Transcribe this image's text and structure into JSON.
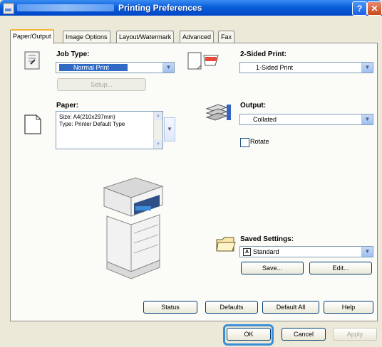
{
  "window": {
    "title": "Printing Preferences",
    "help_glyph": "?",
    "close_glyph": "✕"
  },
  "tabs": [
    {
      "label": "Paper/Output",
      "active": true
    },
    {
      "label": "Image Options",
      "active": false
    },
    {
      "label": "Layout/Watermark",
      "active": false
    },
    {
      "label": "Advanced",
      "active": false
    },
    {
      "label": "Fax",
      "active": false
    }
  ],
  "job_type": {
    "label": "Job Type:",
    "value": "Normal Print",
    "setup_label": "Setup..."
  },
  "two_sided": {
    "label": "2-Sided Print:",
    "value": "1-Sided Print"
  },
  "paper": {
    "label": "Paper:",
    "size_line": "Size: A4(210x297mm)",
    "type_line": "Type: Printer Default Type"
  },
  "output": {
    "label": "Output:",
    "value": "Collated",
    "rotate_label": "Rotate"
  },
  "saved_settings": {
    "label": "Saved Settings:",
    "value": "Standard",
    "save_label": "Save...",
    "edit_label": "Edit..."
  },
  "bottom_buttons": {
    "status": "Status",
    "defaults": "Defaults",
    "default_all": "Default All",
    "help": "Help"
  },
  "dialog_buttons": {
    "ok": "OK",
    "cancel": "Cancel",
    "apply": "Apply"
  },
  "icons": {
    "dropdown": "▼",
    "scroll_up": "▲",
    "scroll_down": "▼",
    "saved_badge": "A"
  },
  "colors": {
    "title_bar": "#0b5fd9",
    "selection": "#316ac5",
    "ok_highlight": "#3b8ed8",
    "dialog_bg": "#ece9d8"
  }
}
